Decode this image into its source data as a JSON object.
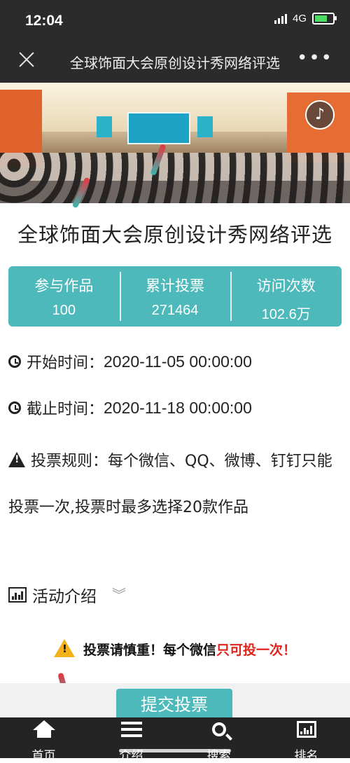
{
  "status_bar": {
    "time": "12:04",
    "network": "4G"
  },
  "nav": {
    "title": "全球饰面大会原创设计秀网络评选"
  },
  "banner": {
    "music_glyph": "♪"
  },
  "event": {
    "title": "全球饰面大会原创设计秀网络评选"
  },
  "stats": [
    {
      "label": "参与作品",
      "value": "100"
    },
    {
      "label": "累计投票",
      "value": "271464"
    },
    {
      "label": "访问次数",
      "value": "102.6万"
    }
  ],
  "info": {
    "start_label": "开始时间：",
    "start_value": "2020-11-05 00:00:00",
    "end_label": "截止时间：",
    "end_value": "2020-11-18 00:00:00",
    "rules_label": "投票规则：",
    "rules_text": "每个微信、QQ、微博、钉钉只能投票一次,投票时最多选择20款作品",
    "intro_label": "活动介绍",
    "intro_chevron": "︾"
  },
  "notice": {
    "text_black": "投票请慎重！每个微信",
    "text_red": "只可投一次！"
  },
  "submit_label": "提交投票",
  "tabs": [
    {
      "label": "首页",
      "icon": "home-icon"
    },
    {
      "label": "介绍",
      "icon": "menu-icon"
    },
    {
      "label": "搜索",
      "icon": "search-icon"
    },
    {
      "label": "排名",
      "icon": "ranking-icon"
    }
  ],
  "colors": {
    "accent": "#4db9bb",
    "dark": "#2b2b2b",
    "warning_red": "#e0241b",
    "warning_yellow": "#f2b21b"
  }
}
